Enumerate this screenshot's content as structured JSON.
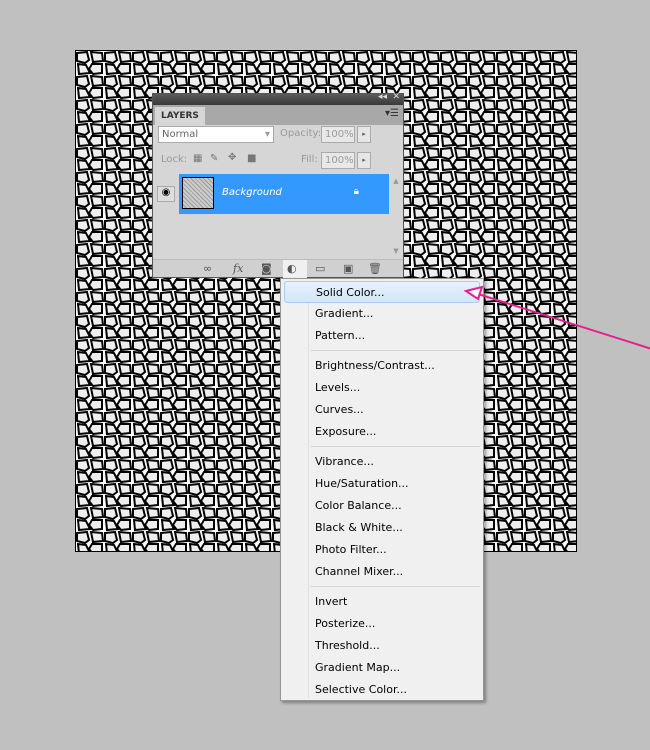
{
  "layers_panel": {
    "tab": "LAYERS",
    "blend_mode": "Normal",
    "opacity_label": "Opacity:",
    "opacity": "100%",
    "lock_label": "Lock:",
    "fill_label": "Fill:",
    "fill": "100%",
    "layer": {
      "name": "Background"
    }
  },
  "menu": {
    "groups": [
      [
        "Solid Color...",
        "Gradient...",
        "Pattern..."
      ],
      [
        "Brightness/Contrast...",
        "Levels...",
        "Curves...",
        "Exposure..."
      ],
      [
        "Vibrance...",
        "Hue/Saturation...",
        "Color Balance...",
        "Black & White...",
        "Photo Filter...",
        "Channel Mixer..."
      ],
      [
        "Invert",
        "Posterize...",
        "Threshold...",
        "Gradient Map...",
        "Selective Color..."
      ]
    ],
    "highlighted": "Solid Color..."
  },
  "colors": {
    "selection": "#3399ff",
    "arrow": "#e0228c"
  }
}
